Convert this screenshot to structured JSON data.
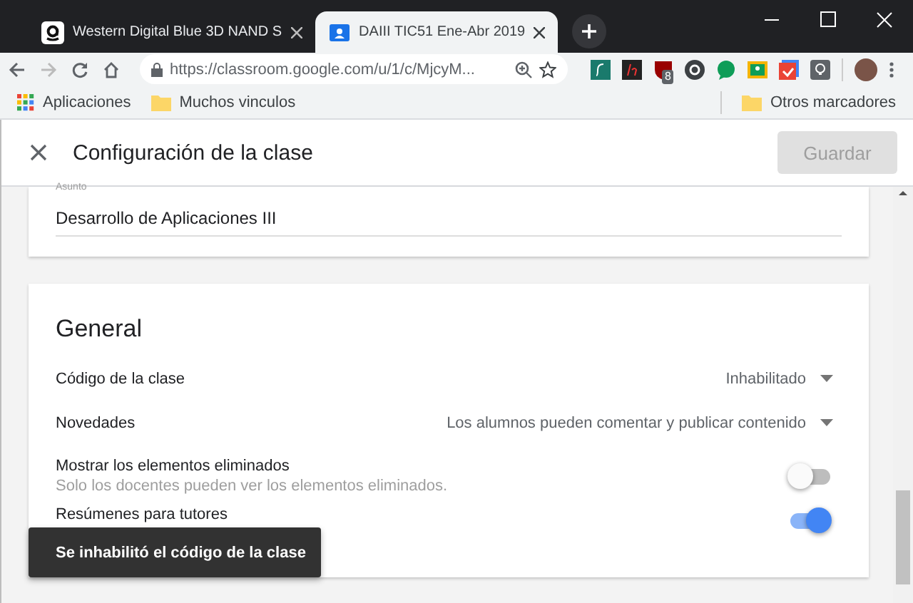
{
  "browser": {
    "tabs": [
      {
        "title": "Western Digital Blue 3D NAND S",
        "kind": "shop",
        "selected": false
      },
      {
        "title": "DAIII TIC51 Ene-Abr 2019",
        "kind": "classroom",
        "selected": true
      }
    ],
    "address": "https://classroom.google.com/u/1/c/MjcyM...",
    "extension_badge": "8",
    "bookmarks": [
      {
        "label": "Aplicaciones",
        "kind": "apps"
      },
      {
        "label": "Muchos vinculos",
        "kind": "folder"
      }
    ],
    "other_bookmarks": "Otros marcadores"
  },
  "header": {
    "title": "Configuración de la clase",
    "save_button": {
      "label": "Guardar",
      "disabled": true
    }
  },
  "subject_field": {
    "label": "Asunto",
    "value": "Desarrollo de Aplicaciones III"
  },
  "general": {
    "heading": "General",
    "settings": [
      {
        "kind": "dropdown",
        "label": "Código de la clase",
        "value": "Inhabilitado"
      },
      {
        "kind": "dropdown",
        "label": "Novedades",
        "value": "Los alumnos pueden comentar y publicar contenido"
      },
      {
        "kind": "toggle",
        "label": "Mostrar los elementos eliminados",
        "description": "Solo los docentes pueden ver los elementos eliminados.",
        "on": false
      },
      {
        "kind": "toggle",
        "label": "Resúmenes para tutores",
        "on": true
      }
    ]
  },
  "snackbar": {
    "message": "Se inhabilitó el código de la clase"
  }
}
